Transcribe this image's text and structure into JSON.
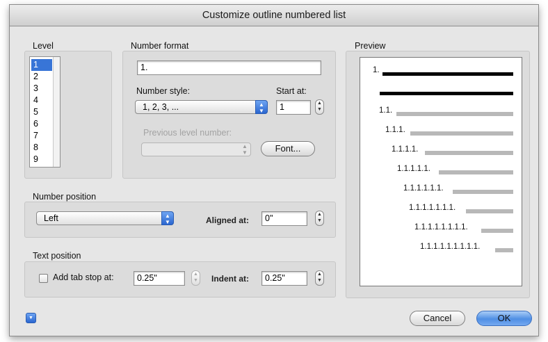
{
  "dialog": {
    "title": "Customize outline numbered list"
  },
  "level": {
    "label": "Level",
    "items": [
      "1",
      "2",
      "3",
      "4",
      "5",
      "6",
      "7",
      "8",
      "9"
    ],
    "selected": "1"
  },
  "number_format": {
    "label": "Number format",
    "format_value": "1.",
    "number_style_label": "Number style:",
    "number_style_value": "1, 2, 3, ...",
    "start_at_label": "Start at:",
    "start_at_value": "1",
    "previous_level_label": "Previous level number:",
    "previous_level_value": "",
    "font_button": "Font..."
  },
  "number_position": {
    "label": "Number position",
    "alignment_value": "Left",
    "aligned_at_label": "Aligned at:",
    "aligned_at_value": "0\""
  },
  "text_position": {
    "label": "Text position",
    "add_tab_stop_label": "Add tab stop at:",
    "add_tab_stop_checked": false,
    "tab_stop_value": "0.25\"",
    "indent_at_label": "Indent at:",
    "indent_at_value": "0.25\""
  },
  "preview": {
    "label": "Preview",
    "lines": [
      "1.",
      "",
      "1.1.",
      "1.1.1.",
      "1.1.1.1.",
      "1.1.1.1.1.",
      "1.1.1.1.1.1.",
      "1.1.1.1.1.1.1.",
      "1.1.1.1.1.1.1.1.",
      "1.1.1.1.1.1.1.1.1."
    ]
  },
  "buttons": {
    "cancel": "Cancel",
    "ok": "OK"
  },
  "colors": {
    "selection": "#3875d7",
    "accent": "#2a66d0"
  },
  "icons": {
    "popup": "updown-arrows-icon",
    "stepper": "stepper-arrows-icon",
    "help": "disclosure-triangle-icon"
  }
}
